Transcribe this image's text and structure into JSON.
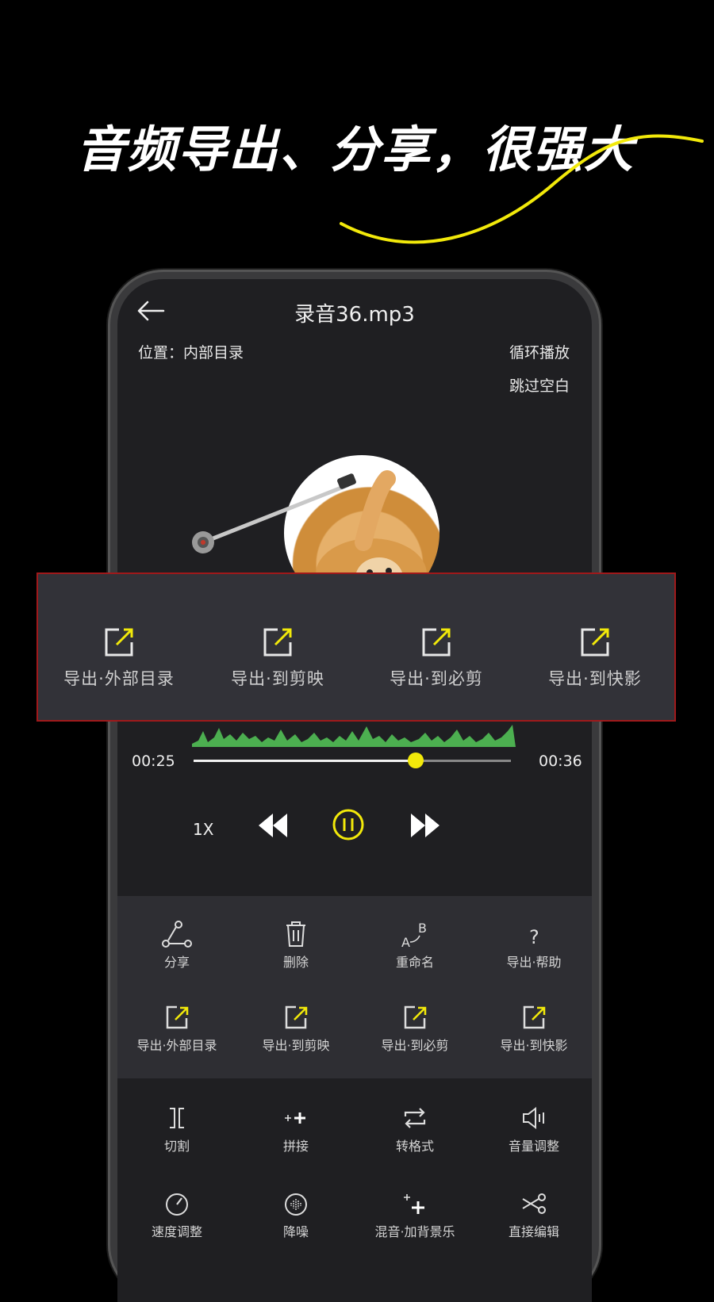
{
  "headline": "音频导出、分享，很强大",
  "colors": {
    "accent": "#F2E90A",
    "waveform": "#4CAF50",
    "highlight_border": "#A0191B"
  },
  "player": {
    "title": "录音36.mp3",
    "location": "位置：内部目录",
    "loop": "循环播放",
    "skip_silence": "跳过空白",
    "current_time": "00:25",
    "total_time": "00:36",
    "progress": 0.7,
    "speed": "1X"
  },
  "export_menu": [
    {
      "label": "导出·外部目录",
      "icon": "export-icon"
    },
    {
      "label": "导出·到剪映",
      "icon": "export-icon"
    },
    {
      "label": "导出·到必剪",
      "icon": "export-icon"
    },
    {
      "label": "导出·到快影",
      "icon": "export-icon"
    }
  ],
  "actions_row1": [
    {
      "label": "分享",
      "icon": "share-icon"
    },
    {
      "label": "删除",
      "icon": "trash-icon"
    },
    {
      "label": "重命名",
      "icon": "rename-icon"
    },
    {
      "label": "导出·帮助",
      "icon": "help-icon"
    }
  ],
  "actions_row2": [
    {
      "label": "导出·外部目录",
      "icon": "export-icon"
    },
    {
      "label": "导出·到剪映",
      "icon": "export-icon"
    },
    {
      "label": "导出·到必剪",
      "icon": "export-icon"
    },
    {
      "label": "导出·到快影",
      "icon": "export-icon"
    }
  ],
  "tools_row1": [
    {
      "label": "切割",
      "icon": "cut-brackets-icon"
    },
    {
      "label": "拼接",
      "icon": "join-icon"
    },
    {
      "label": "转格式",
      "icon": "convert-icon"
    },
    {
      "label": "音量调整",
      "icon": "volume-icon"
    }
  ],
  "tools_row2": [
    {
      "label": "速度调整",
      "icon": "speed-icon"
    },
    {
      "label": "降噪",
      "icon": "denoise-icon"
    },
    {
      "label": "混音·加背景乐",
      "icon": "mix-icon"
    },
    {
      "label": "直接编辑",
      "icon": "scissors-icon"
    }
  ]
}
